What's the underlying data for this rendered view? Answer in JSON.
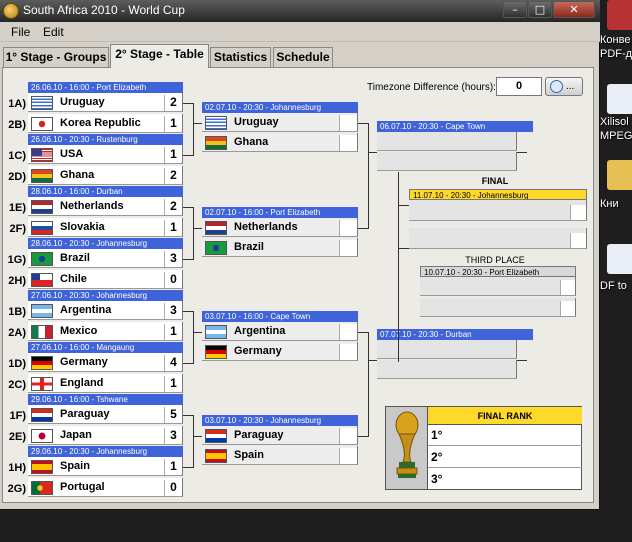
{
  "window": {
    "title": "South Africa 2010 - World Cup",
    "buttons": [
      "–",
      "□",
      "✕"
    ]
  },
  "menu": [
    "File",
    "Edit"
  ],
  "tabs": [
    "1° Stage - Groups",
    "2° Stage - Table",
    "Statistics",
    "Schedule"
  ],
  "timezone": {
    "label": "Timezone Difference (hours):",
    "value": "0",
    "button": "..."
  },
  "round16": [
    {
      "header": "26.06.10 - 16:00 - Port Elizabeth",
      "teams": [
        {
          "seed": "1A)",
          "name": "Uruguay",
          "score": "2"
        },
        {
          "seed": "2B)",
          "name": "Korea Republic",
          "score": "1"
        }
      ]
    },
    {
      "header": "26.06.10 - 20:30 - Rustenburg",
      "teams": [
        {
          "seed": "1C)",
          "name": "USA",
          "score": "1"
        },
        {
          "seed": "2D)",
          "name": "Ghana",
          "score": "2"
        }
      ]
    },
    {
      "header": "28.06.10 - 16:00 - Durban",
      "teams": [
        {
          "seed": "1E)",
          "name": "Netherlands",
          "score": "2"
        },
        {
          "seed": "2F)",
          "name": "Slovakia",
          "score": "1"
        }
      ]
    },
    {
      "header": "28.06.10 - 20:30 - Johannesburg",
      "teams": [
        {
          "seed": "1G)",
          "name": "Brazil",
          "score": "3"
        },
        {
          "seed": "2H)",
          "name": "Chile",
          "score": "0"
        }
      ]
    },
    {
      "header": "27.06.10 - 20:30 - Johannesburg",
      "teams": [
        {
          "seed": "1B)",
          "name": "Argentina",
          "score": "3"
        },
        {
          "seed": "2A)",
          "name": "Mexico",
          "score": "1"
        }
      ]
    },
    {
      "header": "27.06.10 - 16:00 - Mangaung",
      "teams": [
        {
          "seed": "1D)",
          "name": "Germany",
          "score": "4"
        },
        {
          "seed": "2C)",
          "name": "England",
          "score": "1"
        }
      ]
    },
    {
      "header": "29.06.10 - 16:00 - Tshwane",
      "teams": [
        {
          "seed": "1F)",
          "name": "Paraguay",
          "score": "5"
        },
        {
          "seed": "2E)",
          "name": "Japan",
          "score": "3"
        }
      ]
    },
    {
      "header": "29.06.10 - 20:30 - Johannesburg",
      "teams": [
        {
          "seed": "1H)",
          "name": "Spain",
          "score": "1"
        },
        {
          "seed": "2G)",
          "name": "Portugal",
          "score": "0"
        }
      ]
    }
  ],
  "quarters": [
    {
      "header": "02.07.10 - 20:30 - Johannesburg",
      "teams": [
        "Uruguay",
        "Ghana"
      ]
    },
    {
      "header": "02.07.10 - 16:00 - Port Elizabeth",
      "teams": [
        "Netherlands",
        "Brazil"
      ]
    },
    {
      "header": "03.07.10 - 16:00 - Cape Town",
      "teams": [
        "Argentina",
        "Germany"
      ]
    },
    {
      "header": "03.07.10 - 20:30 - Johannesburg",
      "teams": [
        "Paraguay",
        "Spain"
      ]
    }
  ],
  "semis": [
    {
      "header": "06.07.10 - 20:30 - Cape Town"
    },
    {
      "header": "07.07.10 - 20:30 - Durban"
    }
  ],
  "final": {
    "label": "FINAL",
    "header": "11.07.10 - 20:30 - Johannesburg"
  },
  "third_place": {
    "label": "THIRD PLACE",
    "header": "10.07.10 - 20:30 - Port Elizabeth"
  },
  "final_rank": {
    "title": "FINAL RANK",
    "places": [
      "1°",
      "2°",
      "3°"
    ]
  },
  "desktop": {
    "labels": [
      "Конве",
      "PDF-д",
      "Xilisol",
      "MPEG",
      "Кни",
      "DF to"
    ]
  },
  "colors": {
    "match_header": "#3f63d8",
    "final_header": "#ffd92a",
    "third_header": "#d8d8d8"
  }
}
